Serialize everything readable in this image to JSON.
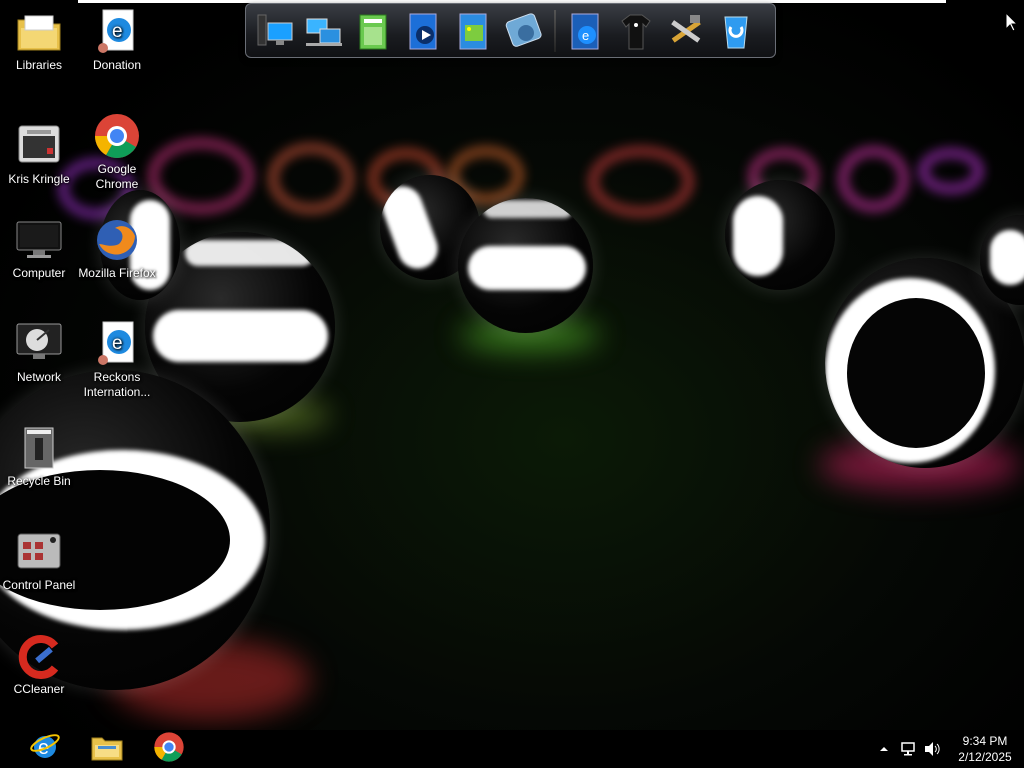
{
  "desktop": {
    "icons": [
      {
        "label": "Libraries",
        "icon": "libraries-folder-icon"
      },
      {
        "label": "Donation",
        "icon": "internet-explorer-shortcut-icon"
      },
      {
        "label": "Kris Kringle",
        "icon": "kris-kringle-app-icon"
      },
      {
        "label": "Google Chrome",
        "icon": "chrome-icon"
      },
      {
        "label": "Computer",
        "icon": "computer-monitor-icon"
      },
      {
        "label": "Mozilla Firefox",
        "icon": "firefox-icon"
      },
      {
        "label": "Network",
        "icon": "network-satellite-icon"
      },
      {
        "label": "Reckons Internation...",
        "icon": "internet-explorer-shortcut-icon"
      },
      {
        "label": "Recycle Bin",
        "icon": "recycle-bin-icon"
      },
      {
        "label": "Control Panel",
        "icon": "control-panel-icon"
      },
      {
        "label": "CCleaner",
        "icon": "ccleaner-icon"
      }
    ]
  },
  "dock": {
    "icons": [
      "my-computer-dock-icon",
      "network-dock-icon",
      "documents-dock-icon",
      "media-player-dock-icon",
      "pictures-dock-icon",
      "disk-drive-dock-icon",
      "internet-explorer-dock-icon",
      "shirt-dock-icon",
      "tools-dock-icon",
      "recycle-bin-dock-icon"
    ]
  },
  "taskbar": {
    "pinned": [
      "internet-explorer-icon",
      "file-explorer-icon",
      "chrome-icon"
    ],
    "tray": {
      "time": "9:34 PM",
      "date": "2/12/2025",
      "icons": [
        "show-hidden-icons-arrow",
        "network-icon",
        "volume-icon"
      ]
    }
  },
  "colors": {
    "taskbar": "#000000",
    "label_text": "#ffffff",
    "dock_bg": "#2a2c31"
  }
}
